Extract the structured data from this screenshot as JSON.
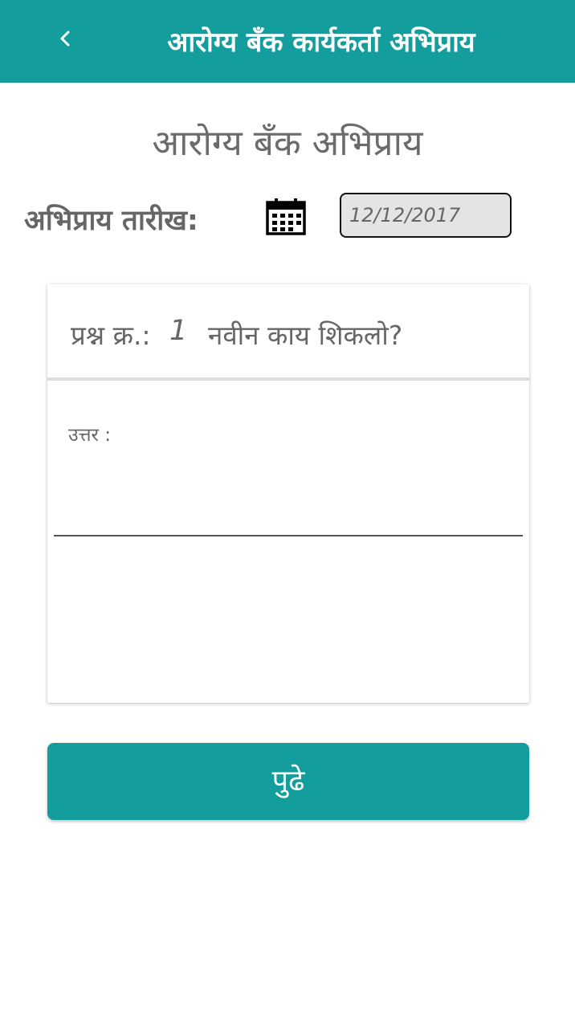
{
  "appbar": {
    "title": "आरोग्य बँक कार्यकर्ता अभिप्राय",
    "back_icon": "chevron-left-icon",
    "color": "#139d9d"
  },
  "page": {
    "title": "आरोग्य बँक अभिप्राय"
  },
  "date_field": {
    "label": "अभिप्राय तारीख:",
    "icon": "calendar-icon",
    "value": "12/12/2017"
  },
  "question_card": {
    "label": "प्रश्न क्र.:",
    "number": "1",
    "text": "नवीन काय शिकलो?",
    "answer_label": "उत्तर :",
    "answer_value": ""
  },
  "next_button": {
    "label": "पुढे",
    "color": "#139d9d"
  }
}
